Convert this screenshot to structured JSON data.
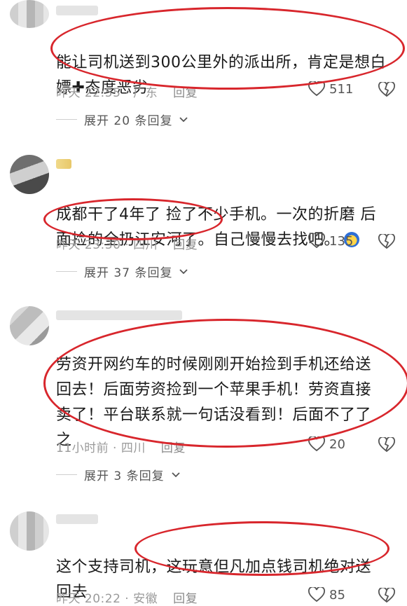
{
  "comments": [
    {
      "line1": "能让司机送到300公里外的派出所，肯定是想白",
      "line2": "嫖✚态度恶劣",
      "time": "昨天 22:55 · 广东",
      "reply_label": "回复",
      "likes": "511",
      "expand": "展开 20 条回复"
    },
    {
      "line1": "成都干了4年了 捡了不少手机。一次的折磨 后",
      "line2": "面捡的全扔江安河了。自己慢慢去找吧。",
      "time": "昨天 23:30 · 四川",
      "reply_label": "回复",
      "likes": "135",
      "expand": "展开 37 条回复"
    },
    {
      "line1": "劳资开网约车的时候刚刚开始捡到手机还给送",
      "line2": "回去！后面劳资捡到一个苹果手机！劳资直接",
      "line3": "卖了！平台联系就一句话没看到！后面不了了",
      "line4": "之",
      "time": "11小时前 · 四川",
      "reply_label": "回复",
      "likes": "20",
      "expand": "展开 3 条回复"
    },
    {
      "line1": "这个支持司机，这玩意但凡加点钱司机绝对送",
      "line2": "回去",
      "time": "昨天 20:22 · 安徽",
      "reply_label": "回复",
      "likes": "85"
    }
  ],
  "colors": {
    "highlight": "#d8262c",
    "meta": "#9a9a9a"
  },
  "icons": [
    "heart-icon",
    "dislike-heart-icon",
    "chevron-down-icon"
  ]
}
